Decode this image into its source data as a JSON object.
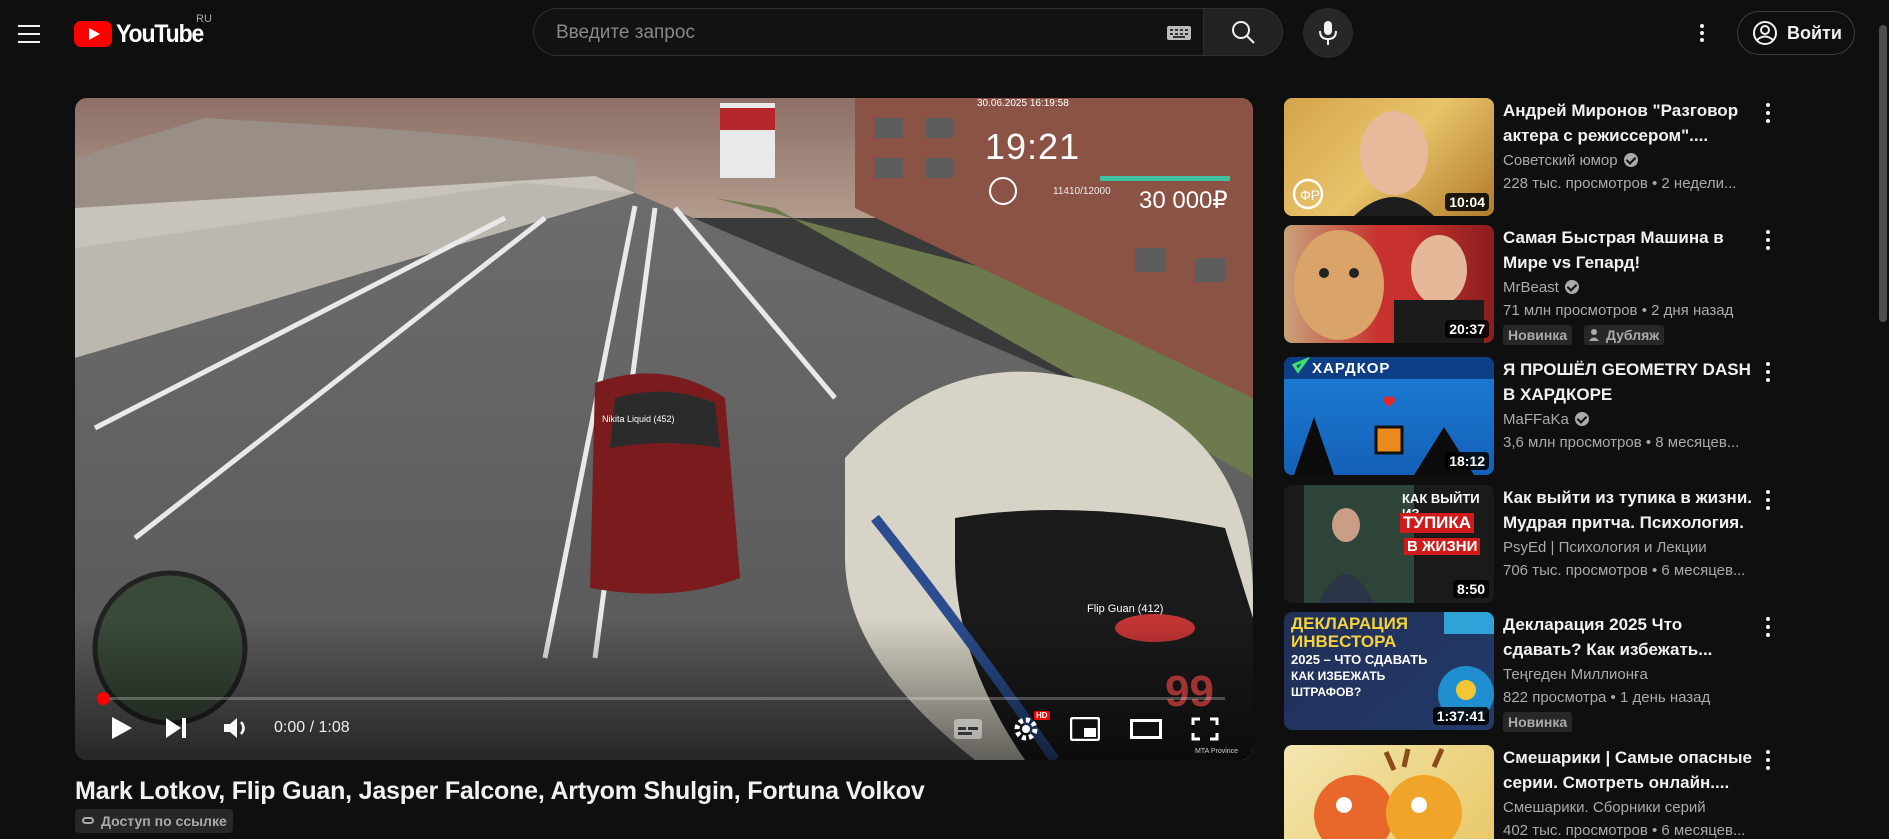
{
  "header": {
    "logo_text": "YouTube",
    "region": "RU",
    "search_placeholder": "Введите запрос",
    "signin_label": "Войти"
  },
  "player": {
    "overlay": {
      "timestamp": "30.06.2025 16:19:58",
      "clock": "19:21",
      "speed": "11410/12000",
      "money": "30 000₽",
      "player_tag_1": "Nikita Liquid (452)",
      "player_tag_2": "Flip Guan (412)",
      "watermark": "MTA Province"
    },
    "time": "0:00 / 1:08",
    "progress": 0.0,
    "quality_badge": "HD"
  },
  "video": {
    "title": "Mark Lotkov, Flip Guan, Jasper Falcone, Artyom Shulgin, Fortuna Volkov",
    "access": "Доступ по ссылке"
  },
  "recommendations": [
    {
      "title": "Андрей Миронов \"Разговор актера с режиссером\"....",
      "channel": "Советский юмор",
      "verified": true,
      "meta": "228 тыс. просмотров  • 2 недели...",
      "duration": "10:04",
      "badges": []
    },
    {
      "title": "Самая Быстрая Машина в Мире vs Гепард!",
      "channel": "MrBeast",
      "verified": true,
      "meta": "71 млн просмотров  • 2 дня назад",
      "duration": "20:37",
      "badges": [
        "Новинка",
        "Дубляж"
      ]
    },
    {
      "title": "Я ПРОШЁЛ GEOMETRY DASH В ХАРДКОРЕ",
      "channel": "MaFFaKa",
      "verified": true,
      "meta": "3,6 млн просмотров  • 8 месяцев...",
      "duration": "18:12",
      "badges": [],
      "thumb_text": "ХАРДКОР"
    },
    {
      "title": "Как выйти из тупика в жизни. Мудрая притча. Психология.",
      "channel": "PsyEd | Психология и Лекции",
      "verified": false,
      "meta": "706 тыс. просмотров  • 6 месяцев...",
      "duration": "8:50",
      "badges": [],
      "thumb_text": [
        "КАК ВЫЙТИ ИЗ",
        "ТУПИКА",
        "В ЖИЗНИ"
      ]
    },
    {
      "title": "Декларация 2025 Что сдавать? Как избежать...",
      "channel": "Теңгеден Миллионға",
      "verified": false,
      "meta": "822 просмотра  • 1 день назад",
      "duration": "1:37:41",
      "badges": [
        "Новинка"
      ],
      "thumb_text": [
        "ДЕКЛАРАЦИЯ",
        "ИНВЕСТОРА",
        "2025 – ЧТО СДАВАТЬ",
        "КАК ИЗБЕЖАТЬ",
        "ШТРАФОВ?"
      ]
    },
    {
      "title": "Смешарики | Самые опасные серии. Смотреть онлайн....",
      "channel": "Смешарики. Сборники серий",
      "verified": false,
      "meta": "402 тыс. просмотров  • 6 месяцев...",
      "duration": "",
      "badges": []
    }
  ]
}
